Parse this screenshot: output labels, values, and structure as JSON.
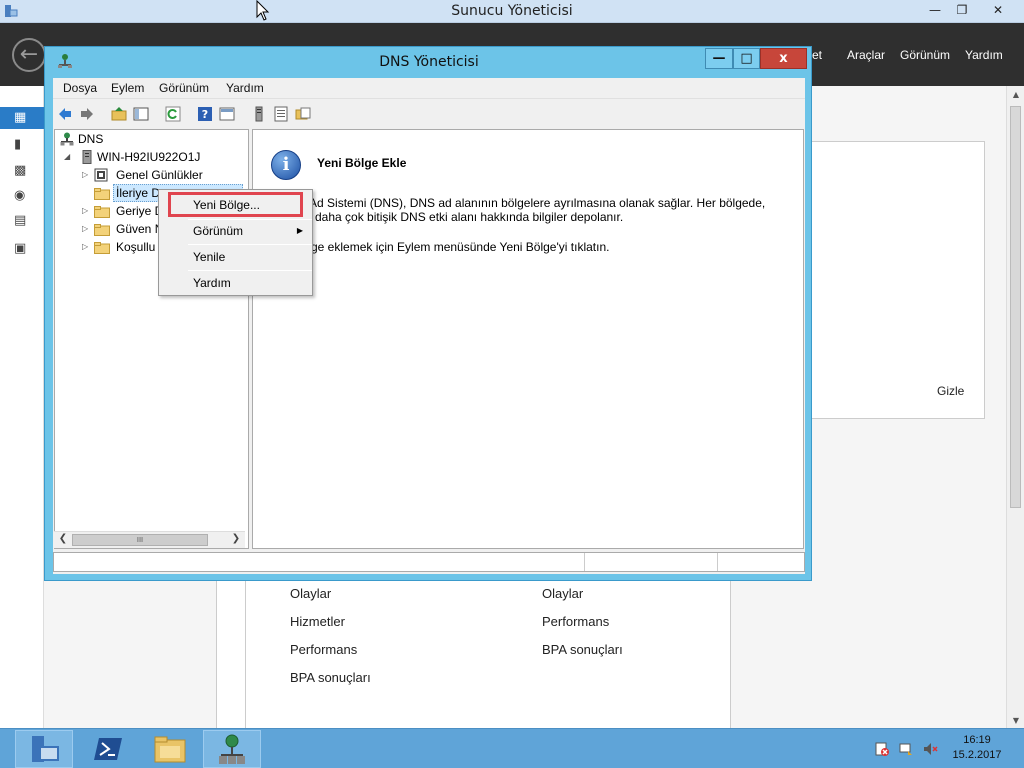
{
  "server_manager": {
    "title": "Sunucu Yöneticisi",
    "window_buttons": [
      "—",
      "❐",
      "✕"
    ],
    "header_menu": [
      "et",
      "Araçlar",
      "Görünüm",
      "Yardım"
    ],
    "nav_letters": [
      "P",
      "Y",
      "T",
      "D",
      "D",
      "I"
    ],
    "hide_label": "Gizle",
    "tile_left_items": [
      "Olaylar",
      "Hizmetler",
      "Performans",
      "BPA sonuçları"
    ],
    "tile_right_items": [
      "Olaylar",
      "Performans",
      "BPA sonuçları"
    ]
  },
  "dns_manager": {
    "title": "DNS Yöneticisi",
    "window_buttons": {
      "minimize": "—",
      "maximize": "□",
      "close": "x"
    },
    "menu": [
      "Dosya",
      "Eylem",
      "Görünüm",
      "Yardım"
    ],
    "toolbar_icons": [
      "back-icon",
      "forward-icon",
      "up-folder-icon",
      "show-hide-tree-icon",
      "refresh-icon",
      "help-icon",
      "properties-icon",
      "server-icon",
      "list-icon",
      "folder-properties-icon"
    ],
    "tree": [
      {
        "label": "DNS",
        "level": 0,
        "expander": "",
        "icon": "dns-icon"
      },
      {
        "label": "WIN-H92IU922O1J",
        "level": 1,
        "expander": "◢",
        "icon": "server-icon"
      },
      {
        "label": "Genel Günlükler",
        "level": 2,
        "expander": "▷",
        "icon": "log-icon"
      },
      {
        "label": "İleriye D",
        "level": 2,
        "expander": "",
        "icon": "folder-icon",
        "selected": true
      },
      {
        "label": "Geriye D",
        "level": 2,
        "expander": "▷",
        "icon": "folder-icon"
      },
      {
        "label": "Güven N",
        "level": 2,
        "expander": "▷",
        "icon": "folder-icon"
      },
      {
        "label": "Koşullu",
        "level": 2,
        "expander": "▷",
        "icon": "folder-icon"
      }
    ],
    "info": {
      "icon_glyph": "i",
      "title": "Yeni Bölge Ekle",
      "line1": "ni Ad Sistemi (DNS), DNS ad alanının bölgelere ayrılmasına olanak sağlar. Her bölgede,",
      "line2": "daha çok bitişik DNS etki alanı hakkında bilgiler depolanır.",
      "line3": "ge eklemek için Eylem menüsünde Yeni Bölge'yi tıklatın."
    },
    "scroll_grip": "III",
    "context_menu": [
      {
        "label": "Yeni Bölge...",
        "submenu": false,
        "highlighted": true
      },
      {
        "label": "Görünüm",
        "submenu": true
      },
      {
        "label": "Yenile",
        "submenu": false
      },
      {
        "label": "Yardım",
        "submenu": false
      }
    ],
    "submenu_arrow": "▶"
  },
  "taskbar": {
    "time": "16:19",
    "date": "15.2.2017",
    "buttons": [
      "server-manager-icon",
      "powershell-icon",
      "file-explorer-icon",
      "dns-manager-icon"
    ]
  },
  "colors": {
    "dns_frame": "#6cc4e8",
    "highlight_box": "#e0454f",
    "taskbar": "#5fa4d8",
    "sm_header": "#2f2f2f"
  }
}
